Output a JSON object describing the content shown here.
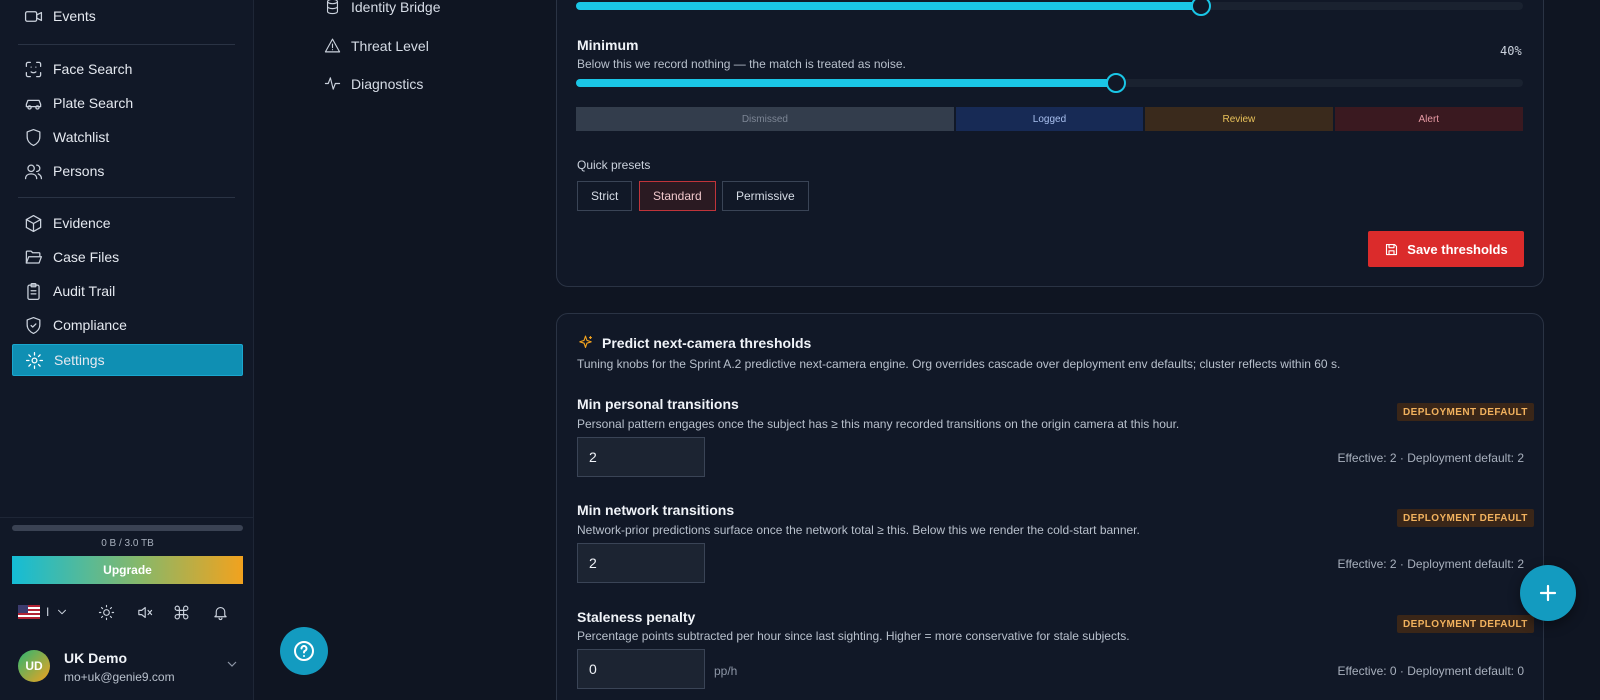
{
  "sidebar": {
    "items": [
      {
        "label": "Events",
        "icon": "video-icon"
      },
      {
        "label": "Face Search",
        "icon": "face-scan-icon"
      },
      {
        "label": "Plate Search",
        "icon": "car-icon"
      },
      {
        "label": "Watchlist",
        "icon": "shield-icon"
      },
      {
        "label": "Persons",
        "icon": "users-icon"
      },
      {
        "label": "Evidence",
        "icon": "box-icon"
      },
      {
        "label": "Case Files",
        "icon": "folder-open-icon"
      },
      {
        "label": "Audit Trail",
        "icon": "clipboard-icon"
      },
      {
        "label": "Compliance",
        "icon": "shield-check-icon"
      },
      {
        "label": "Settings",
        "icon": "gear-icon",
        "active": true
      }
    ],
    "storage": {
      "text": "0 B / 3.0 TB",
      "used_fraction": 0
    },
    "upgrade_label": "Upgrade",
    "language_code": "I",
    "user": {
      "initials": "UD",
      "name": "UK Demo",
      "email": "mo+uk@genie9.com"
    }
  },
  "settings_nav": {
    "items": [
      {
        "label": "Identity Bridge",
        "icon": "database-icon"
      },
      {
        "label": "Threat Level",
        "icon": "warning-triangle-icon"
      },
      {
        "label": "Diagnostics",
        "icon": "activity-icon"
      }
    ]
  },
  "thresholds": {
    "top_slider_value": 66,
    "minimum": {
      "title": "Minimum",
      "description": "Below this we record nothing — the match is treated as noise.",
      "value_label": "40%",
      "value": 57
    },
    "bands": [
      {
        "label": "Dismissed"
      },
      {
        "label": "Logged"
      },
      {
        "label": "Review"
      },
      {
        "label": "Alert"
      }
    ],
    "presets_title": "Quick presets",
    "presets": [
      {
        "label": "Strict"
      },
      {
        "label": "Standard",
        "active": true
      },
      {
        "label": "Permissive"
      }
    ],
    "save_label": "Save thresholds"
  },
  "predict": {
    "title": "Predict next-camera thresholds",
    "description": "Tuning knobs for the Sprint A.2 predictive next-camera engine. Org overrides cascade over deployment env defaults; cluster reflects within 60 s.",
    "fields": [
      {
        "title": "Min personal transitions",
        "description": "Personal pattern engages once the subject has ≥ this many recorded transitions on the origin camera at this hour.",
        "badge": "DEPLOYMENT DEFAULT",
        "value": "2",
        "unit": "",
        "effective": "Effective: 2 · Deployment default: 2"
      },
      {
        "title": "Min network transitions",
        "description": "Network-prior predictions surface once the network total ≥ this. Below this we render the cold-start banner.",
        "badge": "DEPLOYMENT DEFAULT",
        "value": "2",
        "unit": "",
        "effective": "Effective: 2 · Deployment default: 2"
      },
      {
        "title": "Staleness penalty",
        "description": "Percentage points subtracted per hour since last sighting. Higher = more conservative for stale subjects.",
        "badge": "DEPLOYMENT DEFAULT",
        "value": "0",
        "unit": "pp/h",
        "effective": "Effective: 0 · Deployment default: 0"
      }
    ]
  },
  "colors": {
    "accent": "#1ac6e6",
    "danger": "#db2b2b",
    "active_nav": "#0f8fb3"
  }
}
